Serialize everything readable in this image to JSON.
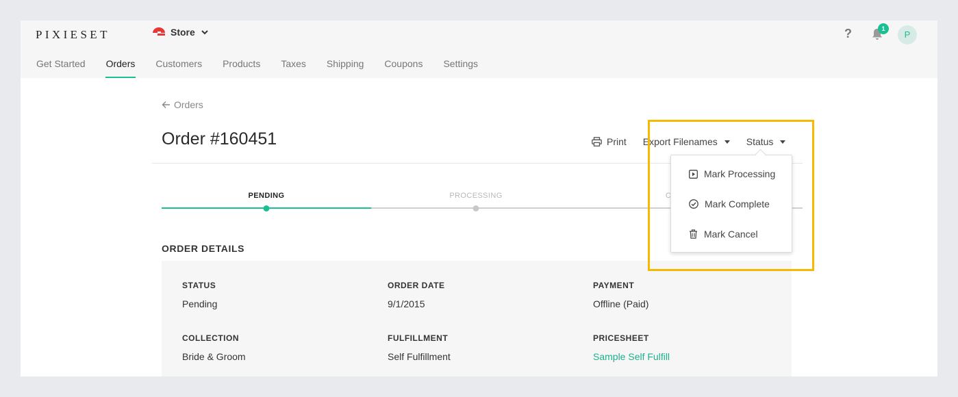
{
  "brand": {
    "logo_text": "PIXIESET"
  },
  "header": {
    "store_switcher_label": "Store",
    "help_label": "?",
    "notification_count": "1",
    "avatar_initial": "P"
  },
  "nav": {
    "items": [
      {
        "label": "Get Started",
        "active": false
      },
      {
        "label": "Orders",
        "active": true
      },
      {
        "label": "Customers",
        "active": false
      },
      {
        "label": "Products",
        "active": false
      },
      {
        "label": "Taxes",
        "active": false
      },
      {
        "label": "Shipping",
        "active": false
      },
      {
        "label": "Coupons",
        "active": false
      },
      {
        "label": "Settings",
        "active": false
      }
    ]
  },
  "breadcrumb": {
    "back_label": "Orders"
  },
  "order": {
    "title": "Order #160451",
    "actions": {
      "print_label": "Print",
      "export_label": "Export Filenames",
      "status_label": "Status"
    }
  },
  "progress": {
    "steps": [
      {
        "label": "PENDING",
        "active": true
      },
      {
        "label": "PROCESSING",
        "active": false
      },
      {
        "label": "C",
        "active": false
      }
    ]
  },
  "status_menu": {
    "items": [
      {
        "label": "Mark Processing",
        "icon": "play-square-icon"
      },
      {
        "label": "Mark Complete",
        "icon": "check-circle-icon"
      },
      {
        "label": "Mark Cancel",
        "icon": "trash-icon"
      }
    ]
  },
  "details": {
    "heading": "ORDER DETAILS",
    "fields": [
      {
        "label": "STATUS",
        "value": "Pending"
      },
      {
        "label": "ORDER DATE",
        "value": "9/1/2015"
      },
      {
        "label": "PAYMENT",
        "value": "Offline (Paid)"
      },
      {
        "label": "COLLECTION",
        "value": "Bride & Groom"
      },
      {
        "label": "FULFILLMENT",
        "value": "Self Fulfillment"
      },
      {
        "label": "PRICESHEET",
        "value": "Sample Self Fulfill"
      }
    ]
  },
  "colors": {
    "accent": "#1bbf94",
    "highlight": "#f6b800",
    "store_logo": "#e53935"
  }
}
